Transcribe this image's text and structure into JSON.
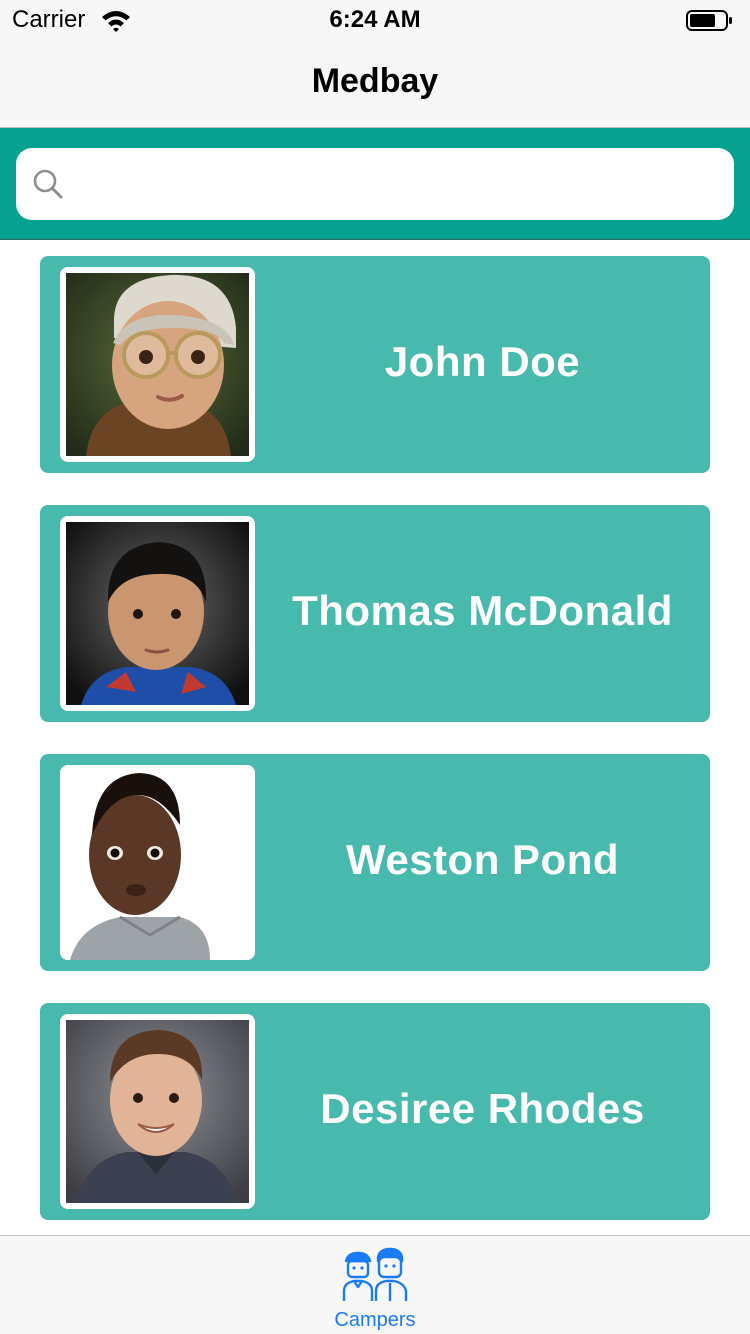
{
  "status_bar": {
    "carrier": "Carrier",
    "time": "6:24 AM",
    "wifi_icon": "wifi-icon",
    "battery_icon": "battery-icon"
  },
  "nav": {
    "title": "Medbay"
  },
  "search": {
    "icon": "search-icon",
    "value": "",
    "placeholder": ""
  },
  "campers": [
    {
      "name": "John Doe"
    },
    {
      "name": "Thomas McDonald"
    },
    {
      "name": "Weston Pond"
    },
    {
      "name": "Desiree Rhodes"
    }
  ],
  "tab_bar": {
    "items": [
      {
        "label": "Campers",
        "icon": "campers-icon",
        "selected": true
      }
    ]
  },
  "colors": {
    "header_band": "#07a190",
    "card": "#47b9ad",
    "card_text": "#ffffff",
    "tab_active": "#1a7cf5",
    "bar_background": "#f7f7f7"
  }
}
